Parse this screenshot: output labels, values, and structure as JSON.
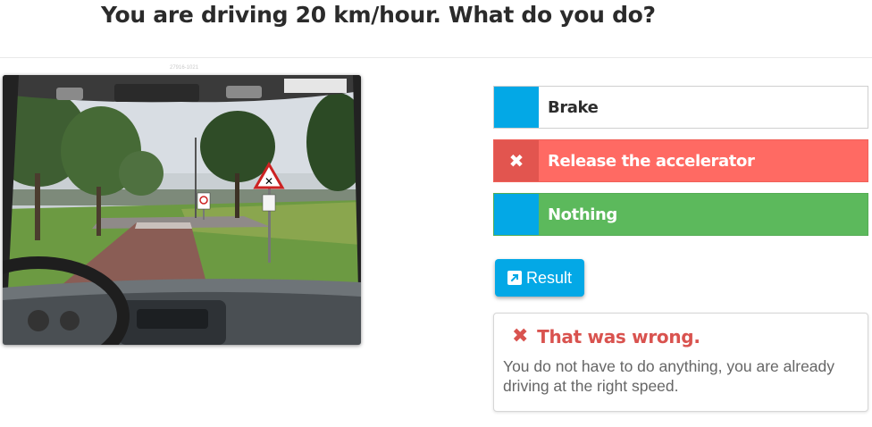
{
  "question": {
    "title": "You are driving 20 km/hour. What do you do?"
  },
  "photo": {
    "caption": "27916-1021",
    "alt_description_icon": "dashboard-road-photo"
  },
  "answers": [
    {
      "label": "Brake",
      "marker_icon": "",
      "state": "neutral"
    },
    {
      "label": "Release the accelerator",
      "marker_icon": "✖",
      "state": "selected-wrong"
    },
    {
      "label": "Nothing",
      "marker_icon": "",
      "state": "correct"
    }
  ],
  "result_button": {
    "label": "Result",
    "icon": "external-link-icon"
  },
  "feedback": {
    "icon": "✖",
    "heading": "That was wrong.",
    "text": "You do not have to do anything, you are already driving at the right speed."
  },
  "colors": {
    "accent_blue": "#03a8e6",
    "wrong_red": "#ff6a63",
    "correct_green": "#5cb95c",
    "feedback_red": "#d9534f"
  }
}
